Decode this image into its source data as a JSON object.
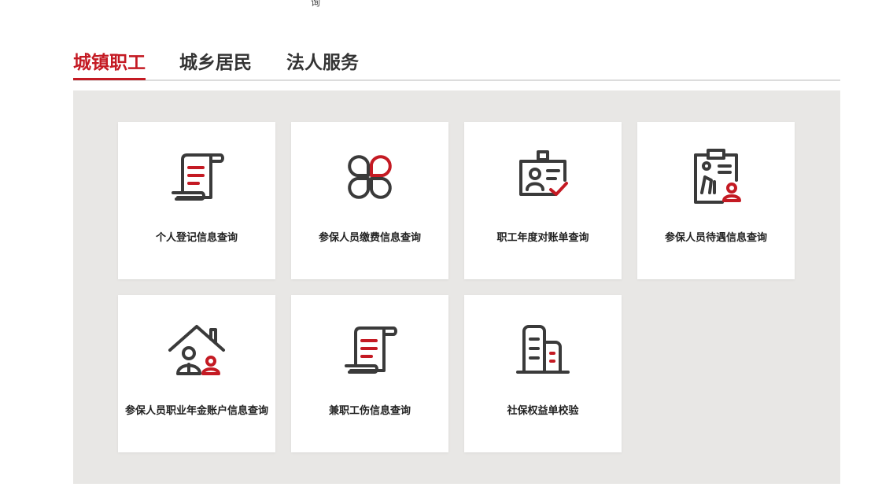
{
  "top_fragment": "询",
  "tabs": [
    {
      "label": "城镇职工",
      "active": true
    },
    {
      "label": "城乡居民",
      "active": false
    },
    {
      "label": "法人服务",
      "active": false
    }
  ],
  "cards": [
    {
      "label": "个人登记信息查询",
      "icon": "document-scroll-icon"
    },
    {
      "label": "参保人员缴费信息查询",
      "icon": "clover-icon"
    },
    {
      "label": "职工年度对账单查询",
      "icon": "id-card-check-icon"
    },
    {
      "label": "参保人员待遇信息查询",
      "icon": "clipboard-elderly-icon"
    },
    {
      "label": "参保人员职业年金账户信息查询",
      "icon": "house-people-icon"
    },
    {
      "label": "兼职工伤信息查询",
      "icon": "document-scroll-icon"
    },
    {
      "label": "社保权益单校验",
      "icon": "buildings-icon"
    }
  ],
  "colors": {
    "accent": "#c41a23",
    "icon_dark": "#3a3a3a",
    "panel_bg": "#e8e7e5"
  }
}
